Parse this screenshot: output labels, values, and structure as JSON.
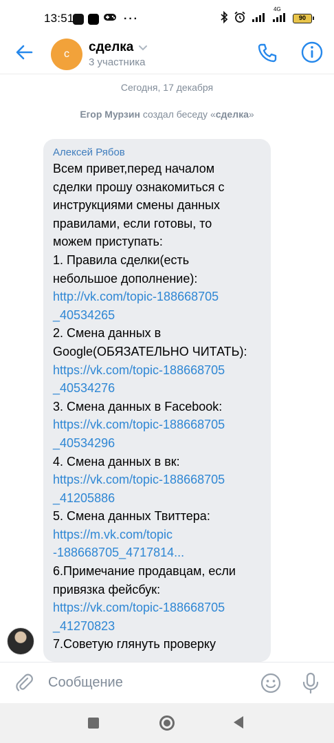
{
  "status_bar": {
    "time": "13:51",
    "network": "4G",
    "battery": "90"
  },
  "header": {
    "avatar_letter": "с",
    "title": "сделка",
    "subtitle": "3 участника"
  },
  "date_separator": "Сегодня, 17 декабря",
  "system_message": {
    "author": "Егор Мурзин",
    "text": " создал беседу «",
    "chat_name": "сделка",
    "close": "»"
  },
  "message": {
    "sender": "Алексей Рябов",
    "lines": [
      {
        "text": "Всем привет,перед началом",
        "link": false
      },
      {
        "text": "сделки прошу ознакомиться с",
        "link": false
      },
      {
        "text": "инструкциями смены данных",
        "link": false
      },
      {
        "text": "правилами, если готовы, то",
        "link": false
      },
      {
        "text": "можем приступать:",
        "link": false
      },
      {
        "text": "1. Правила сделки(есть",
        "link": false
      },
      {
        "text": "небольшое дополнение):",
        "link": false
      },
      {
        "text": "http://vk.com/topic-188668705",
        "link": true
      },
      {
        "text": "_40534265",
        "link": true
      },
      {
        "text": "2. Смена данных в",
        "link": false
      },
      {
        "text": "Google(ОБЯЗАТЕЛЬНО ЧИТАТЬ):",
        "link": false
      },
      {
        "text": "https://vk.com/topic-188668705",
        "link": true
      },
      {
        "text": "_40534276",
        "link": true
      },
      {
        "text": "3. Смена данных в Facebook:",
        "link": false
      },
      {
        "text": "https://vk.com/topic-188668705",
        "link": true
      },
      {
        "text": "_40534296",
        "link": true
      },
      {
        "text": "4. Смена данных в  вк:",
        "link": false
      },
      {
        "text": "https://vk.com/topic-188668705",
        "link": true
      },
      {
        "text": "_41205886",
        "link": true
      },
      {
        "text": "5. Смена данных Твиттера:",
        "link": false
      },
      {
        "text": "https://m.vk.com/topic",
        "link": true
      },
      {
        "text": "-188668705_4717814...",
        "link": true
      },
      {
        "text": "6.Примечание продавцам, если",
        "link": false
      },
      {
        "text": "привязка фейсбук:",
        "link": false
      },
      {
        "text": "https://vk.com/topic-188668705",
        "link": true
      },
      {
        "text": "_41270823",
        "link": true
      },
      {
        "text": "7.Советую глянуть проверку",
        "link": false
      }
    ]
  },
  "composer": {
    "placeholder": "Сообщение"
  },
  "colors": {
    "accent": "#2688eb",
    "link": "#2f87d4",
    "bubble": "#ebedf0",
    "avatar": "#f2a23a"
  },
  "icons": [
    "back-arrow-icon",
    "phone-icon",
    "info-icon",
    "paperclip-icon",
    "smile-icon",
    "microphone-icon"
  ]
}
